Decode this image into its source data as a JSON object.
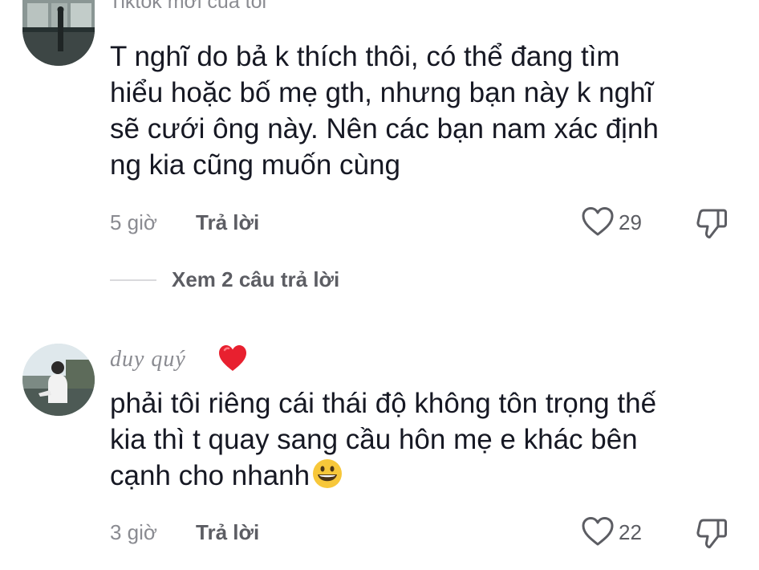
{
  "comment1": {
    "username": "Tiktok mới của tôi",
    "text": "T nghĩ do bả k thích thôi, có thể đang tìm\nhiểu hoặc bố mẹ gth, nhưng bạn này k nghĩ\nsẽ cưới ông này. Nên các bạn nam xác định\nng kia cũng muốn cùng",
    "time": "5 giờ",
    "reply_label": "Trả lời",
    "likes": "29",
    "view_replies": "Xem 2 câu trả lời"
  },
  "comment2": {
    "username": "duy quý",
    "text": "phải tôi riêng cái thái độ không tôn trọng thế\nkia thì t quay sang cầu hôn mẹ e khác bên\ncạnh cho nhanh",
    "time": "3 giờ",
    "reply_label": "Trả lời",
    "likes": "22"
  },
  "icons": {
    "like": "heart-outline-icon",
    "dislike": "thumbs-down-icon",
    "name_emoji": "red-heart-emoji",
    "text_emoji": "grinning-face-emoji"
  },
  "colors": {
    "text": "#161823",
    "secondary": "#8a8b91",
    "action": "#5c5d63",
    "heart_emoji": "#e8202f",
    "smile_emoji": "#f7c73a"
  }
}
